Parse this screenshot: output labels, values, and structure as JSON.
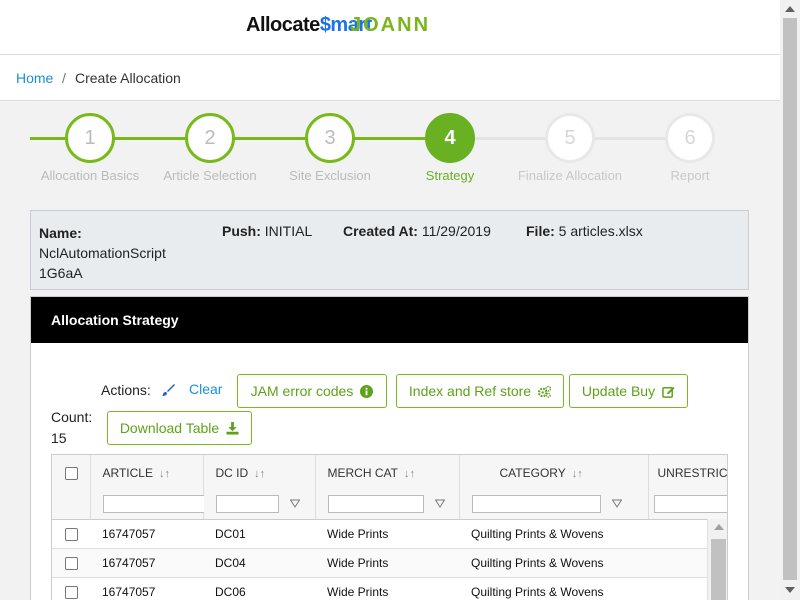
{
  "logo": {
    "part1": "Allocate",
    "part2": "$mart",
    "overlay": "JOANN"
  },
  "breadcrumb": {
    "home": "Home",
    "separator": "/",
    "current": "Create Allocation"
  },
  "steps": [
    {
      "number": "1",
      "label": "Allocation Basics",
      "state": "done"
    },
    {
      "number": "2",
      "label": "Article Selection",
      "state": "done"
    },
    {
      "number": "3",
      "label": "Site Exclusion",
      "state": "done"
    },
    {
      "number": "4",
      "label": "Strategy",
      "state": "active"
    },
    {
      "number": "5",
      "label": "Finalize Allocation",
      "state": "future"
    },
    {
      "number": "6",
      "label": "Report",
      "state": "future"
    }
  ],
  "info": {
    "name_label": "Name:",
    "name_line1": "NclAutomationScript",
    "name_line2": "1G6aA",
    "push_label": "Push:",
    "push_value": "INITIAL",
    "created_label": "Created At:",
    "created_value": "11/29/2019",
    "file_label": "File:",
    "file_value": "5 articles.xlsx"
  },
  "panel": {
    "title": "Allocation Strategy",
    "actions_label": "Actions:",
    "clear_label": "Clear",
    "count_label": "Count:",
    "count_value": "15",
    "buttons": {
      "jam": "JAM error codes",
      "index": "Index and Ref store",
      "update": "Update Buy",
      "download": "Download Table"
    }
  },
  "table": {
    "columns": [
      "ARTICLE",
      "DC ID",
      "MERCH CAT",
      "CATEGORY",
      "UNRESTRICT"
    ],
    "sort_glyph": "↓↑",
    "rows": [
      [
        "16747057",
        "DC01",
        "Wide Prints",
        "Quilting Prints & Wovens"
      ],
      [
        "16747057",
        "DC04",
        "Wide Prints",
        "Quilting Prints & Wovens"
      ],
      [
        "16747057",
        "DC06",
        "Wide Prints",
        "Quilting Prints & Wovens"
      ]
    ]
  },
  "colors": {
    "accent": "#78b91c",
    "active_step": "#6ab023",
    "link": "#1a8fd6",
    "header_bg": "#000000"
  },
  "icons": [
    "brush-icon",
    "info-circle-icon",
    "cogs-icon",
    "edit-icon",
    "download-icon",
    "filter-icon",
    "sort-icon"
  ]
}
